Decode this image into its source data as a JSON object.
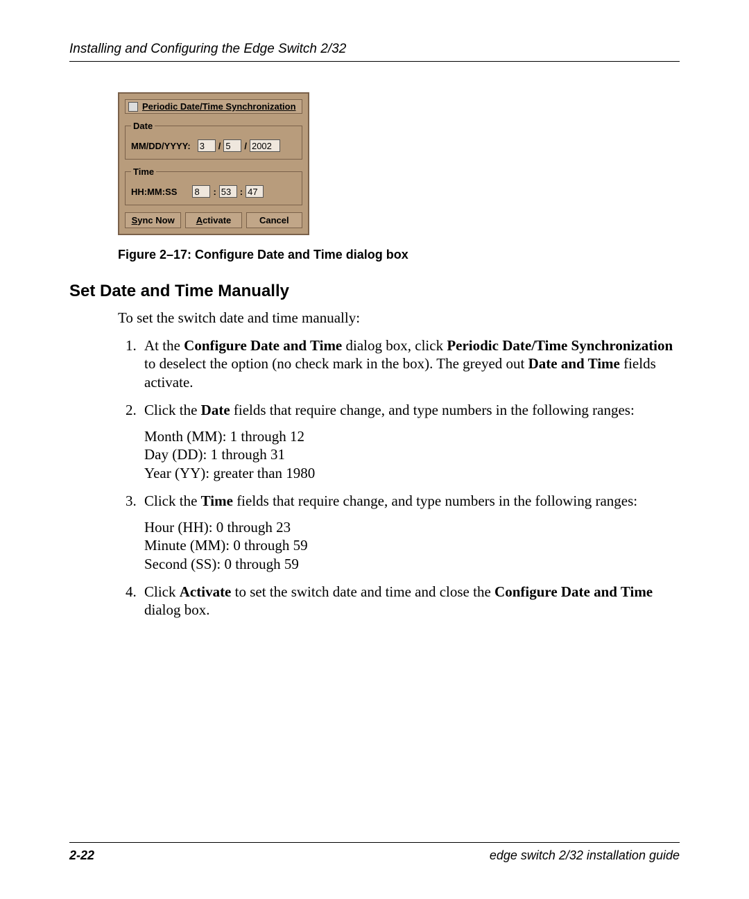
{
  "header": {
    "running_head": "Installing and Configuring the Edge Switch 2/32"
  },
  "dialog": {
    "checkbox_label": "Periodic Date/Time Synchronization",
    "date": {
      "legend": "Date",
      "label": "MM/DD/YYYY:",
      "mm": "3",
      "dd": "5",
      "yyyy": "2002",
      "sep": "/"
    },
    "time": {
      "legend": "Time",
      "label": "HH:MM:SS",
      "hh": "8",
      "mm": "53",
      "ss": "47",
      "sep": ":"
    },
    "buttons": {
      "sync_m": "S",
      "sync_rest": "ync Now",
      "activate_m": "A",
      "activate_rest": "ctivate",
      "cancel": "Cancel"
    }
  },
  "caption": "Figure 2–17:  Configure Date and Time dialog box",
  "heading": "Set Date and Time Manually",
  "intro": "To set the switch date and time manually:",
  "steps": {
    "s1": {
      "t1": "At the ",
      "b1": "Configure Date and Time",
      "t2": " dialog box, click ",
      "b2": "Periodic Date/Time Synchronization",
      "t3": " to deselect the option (no check mark in the box). The greyed out ",
      "b3": "Date and Time",
      "t4": " fields activate."
    },
    "s2": {
      "t1": "Click the ",
      "b1": "Date",
      "t2": " fields that require change, and type numbers in the following ranges:",
      "l1": "Month (MM): 1 through 12",
      "l2": "Day (DD): 1 through 31",
      "l3": "Year (YY): greater than 1980"
    },
    "s3": {
      "t1": "Click the ",
      "b1": "Time",
      "t2": " fields that require change, and type numbers in the following ranges:",
      "l1": "Hour (HH): 0 through 23",
      "l2": "Minute (MM): 0 through 59",
      "l3": "Second (SS): 0 through 59"
    },
    "s4": {
      "t1": "Click ",
      "b1": "Activate",
      "t2": " to set the switch date and time and close the ",
      "b2": "Configure Date and Time",
      "t3": " dialog box."
    }
  },
  "footer": {
    "page": "2-22",
    "title": "edge switch 2/32 installation guide"
  }
}
